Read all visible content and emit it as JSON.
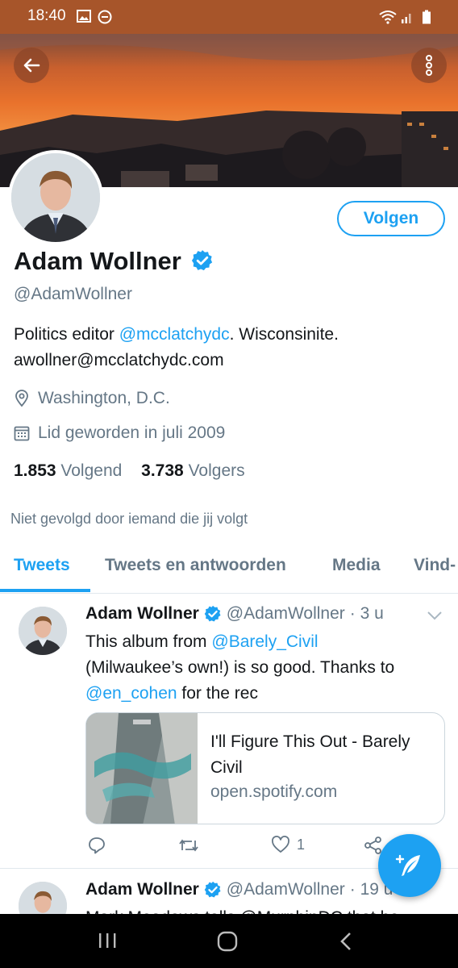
{
  "status_bar": {
    "time": "18:40"
  },
  "profile": {
    "follow_label": "Volgen",
    "name": "Adam Wollner",
    "handle": "@AdamWollner",
    "bio_prefix": "Politics editor ",
    "bio_mention": "@mcclatchydc",
    "bio_suffix": ". Wisconsinite.",
    "bio_line2": "awollner@mcclatchydc.com",
    "location": "Washington, D.C.",
    "joined": "Lid geworden in juli 2009",
    "following_count": "1.853",
    "following_label": "Volgend",
    "followers_count": "3.738",
    "followers_label": "Volgers",
    "not_followed": "Niet gevolgd door iemand die jij volgt"
  },
  "tabs": [
    {
      "label": "Tweets"
    },
    {
      "label": "Tweets en antwoorden"
    },
    {
      "label": "Media"
    },
    {
      "label": "Vind-"
    }
  ],
  "tweets": [
    {
      "name": "Adam Wollner",
      "handle": "@AdamWollner",
      "time": "· 3 u",
      "line1_prefix": "This album from ",
      "line1_mention": "@Barely_Civil",
      "line2": "(Milwaukee’s own!) is so good. Thanks to",
      "line3_mention": "@en_cohen",
      "line3_suffix": " for the rec",
      "card_title": "I'll Figure This Out - Barely Civil",
      "card_domain": "open.spotify.com",
      "likes": "1"
    },
    {
      "name": "Adam Wollner",
      "handle": "@AdamWollner",
      "time": "· 19 u",
      "text": "Mark Meadows tells @MurphinDC that he"
    }
  ],
  "colors": {
    "accent": "#1da1f2",
    "status_bar": "#a7552a",
    "text_secondary": "#657786"
  }
}
